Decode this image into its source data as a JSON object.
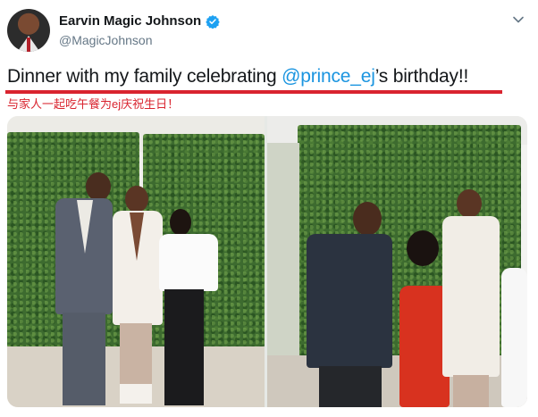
{
  "author": {
    "display_name": "Earvin Magic Johnson",
    "handle": "@MagicJohnson",
    "verified": true
  },
  "tweet": {
    "text_before": "Dinner with my family celebrating ",
    "mention": "@prince_ej",
    "text_after": "’s birthday!!",
    "translation": "与家人一起吃午餐为ej庆祝生日！"
  },
  "colors": {
    "mention": "#1b95e0",
    "annotation": "#d9242f",
    "verified_badge": "#1da1f2"
  },
  "icons": {
    "verified": "verified-badge-icon",
    "menu": "chevron-down-icon"
  },
  "media": {
    "photo_count": 2
  }
}
